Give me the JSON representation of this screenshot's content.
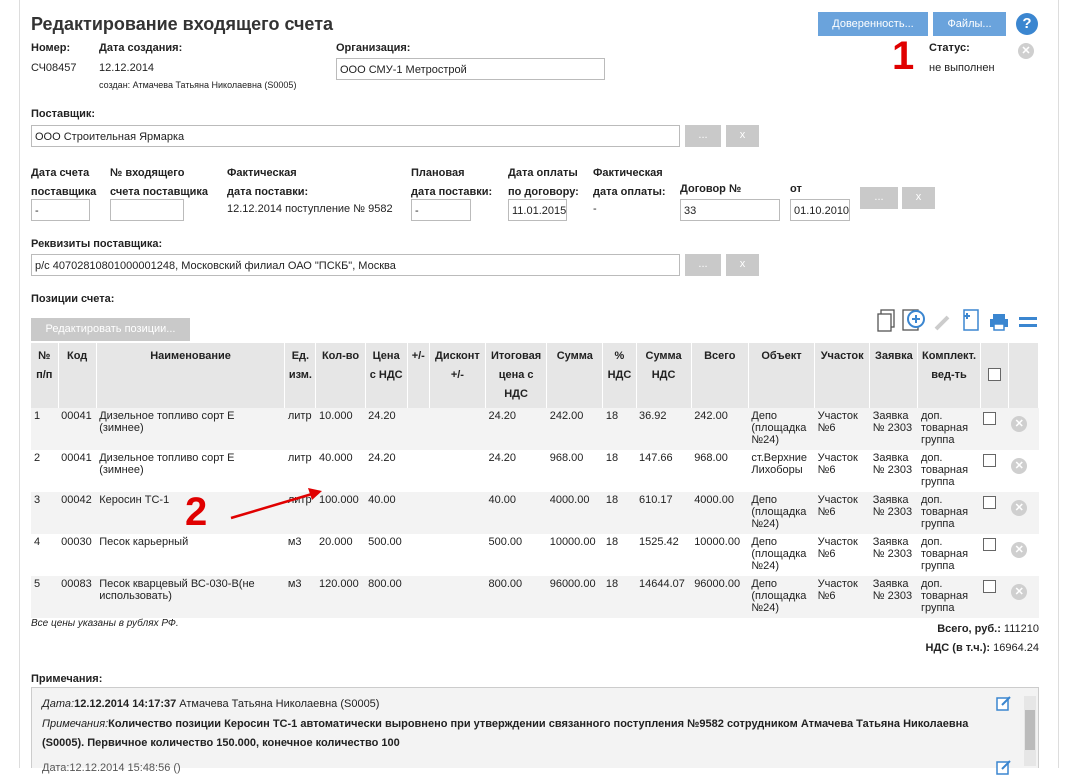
{
  "header": {
    "title": "Редактирование входящего счета",
    "btn_power": "Доверенность...",
    "btn_files": "Файлы...",
    "help": "?"
  },
  "info": {
    "number_label": "Номер:",
    "number": "СЧ08457",
    "created_label": "Дата создания:",
    "created": "12.12.2014",
    "created_by": "создан: Атмачева Татьяна Николаевна (S0005)",
    "org_label": "Организация:",
    "org": "ООО СМУ-1 Метрострой",
    "status_label": "Статус:",
    "status": "не выполнен"
  },
  "supplier": {
    "label": "Поставщик:",
    "value": "ООО Строительная Ярмарка",
    "dots": "...",
    "x": "x"
  },
  "dates": {
    "date_supplier_l1": "Дата счета",
    "date_supplier_l2": "поставщика",
    "date_supplier": "-",
    "inc_no_l1": "№ входящего",
    "inc_no_l2": "счета поставщика",
    "inc_no": "",
    "fact_del_l1": "Фактическая",
    "fact_del_l2": "дата поставки:",
    "fact_del": "12.12.2014 поступление № 9582",
    "plan_del_l1": "Плановая",
    "plan_del_l2": "дата поставки:",
    "plan_del": "-",
    "pay_contract_l1": "Дата оплаты",
    "pay_contract_l2": "по договору:",
    "pay_contract": "11.01.2015",
    "fact_pay_l1": "Фактическая",
    "fact_pay_l2": "дата оплаты:",
    "fact_pay": "-",
    "contract_label": "Договор №",
    "contract": "33",
    "from_label": "от",
    "from": "01.10.2010",
    "dots": "...",
    "x": "x"
  },
  "requisites": {
    "label": "Реквизиты поставщика:",
    "value": "р/с 40702810801000001248, Московский филиал ОАО \"ПСКБ\", Москва",
    "dots": "...",
    "x": "x"
  },
  "positions": {
    "label": "Позиции счета:",
    "edit_btn": "Редактировать позиции...",
    "headers": [
      "№ п/п",
      "Код",
      "Наименование",
      "Ед. изм.",
      "Кол-во",
      "Цена с НДС",
      "+/-",
      "Дисконт +/-",
      "Итоговая цена с НДС",
      "Сумма",
      "% НДС",
      "Сумма НДС",
      "Всего",
      "Объект",
      "Участок",
      "Заявка",
      "Комплект. вед-ть"
    ],
    "rows": [
      {
        "n": "1",
        "code": "00041",
        "name": "Дизельное топливо сорт Е (зимнее)",
        "unit": "литр",
        "qty": "10.000",
        "price": "24.20",
        "pm": "",
        "disc": "",
        "final": "24.20",
        "sum": "242.00",
        "vat_pct": "18",
        "vat_sum": "36.92",
        "total": "242.00",
        "object": "Депо (площадка №24)",
        "site": "Участок №6",
        "req": "Заявка № 2303",
        "kit": "доп. товарная группа"
      },
      {
        "n": "2",
        "code": "00041",
        "name": "Дизельное топливо сорт Е (зимнее)",
        "unit": "литр",
        "qty": "40.000",
        "price": "24.20",
        "pm": "",
        "disc": "",
        "final": "24.20",
        "sum": "968.00",
        "vat_pct": "18",
        "vat_sum": "147.66",
        "total": "968.00",
        "object": "ст.Верхние Лихоборы",
        "site": "Участок №6",
        "req": "Заявка № 2303",
        "kit": "доп. товарная группа"
      },
      {
        "n": "3",
        "code": "00042",
        "name": "Керосин ТС-1",
        "unit": "литр",
        "qty": "100.000",
        "price": "40.00",
        "pm": "",
        "disc": "",
        "final": "40.00",
        "sum": "4000.00",
        "vat_pct": "18",
        "vat_sum": "610.17",
        "total": "4000.00",
        "object": "Депо (площадка №24)",
        "site": "Участок №6",
        "req": "Заявка № 2303",
        "kit": "доп. товарная группа"
      },
      {
        "n": "4",
        "code": "00030",
        "name": "Песок карьерный",
        "unit": "м3",
        "qty": "20.000",
        "price": "500.00",
        "pm": "",
        "disc": "",
        "final": "500.00",
        "sum": "10000.00",
        "vat_pct": "18",
        "vat_sum": "1525.42",
        "total": "10000.00",
        "object": "Депо (площадка №24)",
        "site": "Участок №6",
        "req": "Заявка № 2303",
        "kit": "доп. товарная группа"
      },
      {
        "n": "5",
        "code": "00083",
        "name": "Песок кварцевый ВС-030-В(не использовать)",
        "unit": "м3",
        "qty": "120.000",
        "price": "800.00",
        "pm": "",
        "disc": "",
        "final": "800.00",
        "sum": "96000.00",
        "vat_pct": "18",
        "vat_sum": "14644.07",
        "total": "96000.00",
        "object": "Депо (площадка №24)",
        "site": "Участок №6",
        "req": "Заявка № 2303",
        "kit": "доп. товарная группа"
      }
    ],
    "currency_note": "Все цены указаны в рублях РФ.",
    "total_label": "Всего, руб.:",
    "total": "111210",
    "vat_label": "НДС (в т.ч.):",
    "vat": "16964.24"
  },
  "notes": {
    "label": "Примечания:",
    "date_label": "Дата:",
    "date": "12.12.2014 14:17:37",
    "author": "Атмачева Татьяна Николаевна (S0005)",
    "note_label": "Примечания:",
    "note_text": "Количество позиции Керосин ТС-1 автоматически выровнено при утверждении связанного поступления №9582 сотрудником Атмачева Татьяна Николаевна (S0005). Первичное количество 150.000, конечное количество 100",
    "second_date": "Дата:12.12.2014 15:48:56 ()"
  },
  "annotations": {
    "one": "1",
    "two": "2"
  }
}
